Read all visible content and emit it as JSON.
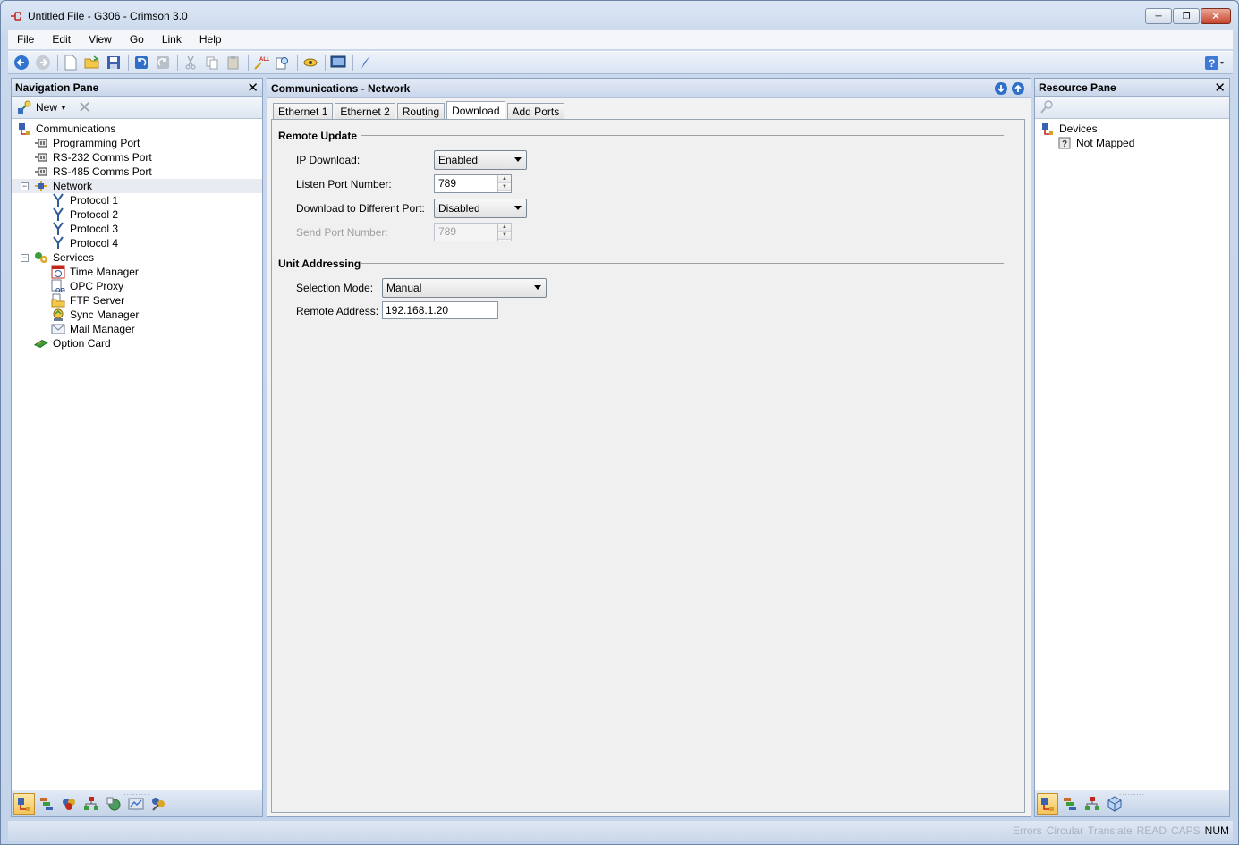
{
  "window": {
    "title": "Untitled File - G306 - Crimson 3.0"
  },
  "menu": [
    "File",
    "Edit",
    "View",
    "Go",
    "Link",
    "Help"
  ],
  "nav_pane": {
    "title": "Navigation Pane",
    "new_label": "New",
    "tree": [
      {
        "label": "Communications",
        "level": 0,
        "icon": "communications-icon"
      },
      {
        "label": "Programming Port",
        "level": 1,
        "icon": "port-icon"
      },
      {
        "label": "RS-232 Comms Port",
        "level": 1,
        "icon": "port-icon"
      },
      {
        "label": "RS-485 Comms Port",
        "level": 1,
        "icon": "port-icon"
      },
      {
        "label": "Network",
        "level": 1,
        "icon": "network-icon",
        "expanded": true,
        "selected": true
      },
      {
        "label": "Protocol 1",
        "level": 2,
        "icon": "protocol-icon"
      },
      {
        "label": "Protocol 2",
        "level": 2,
        "icon": "protocol-icon"
      },
      {
        "label": "Protocol 3",
        "level": 2,
        "icon": "protocol-icon"
      },
      {
        "label": "Protocol 4",
        "level": 2,
        "icon": "protocol-icon"
      },
      {
        "label": "Services",
        "level": 1,
        "icon": "services-icon",
        "expanded": true
      },
      {
        "label": "Time Manager",
        "level": 2,
        "icon": "clock-icon"
      },
      {
        "label": "OPC Proxy",
        "level": 2,
        "icon": "opc-icon"
      },
      {
        "label": "FTP Server",
        "level": 2,
        "icon": "folder-icon"
      },
      {
        "label": "Sync Manager",
        "level": 2,
        "icon": "sync-icon"
      },
      {
        "label": "Mail Manager",
        "level": 2,
        "icon": "mail-icon"
      },
      {
        "label": "Option Card",
        "level": 1,
        "icon": "card-icon"
      }
    ]
  },
  "main": {
    "title": "Communications - Network",
    "tabs": [
      "Ethernet 1",
      "Ethernet 2",
      "Routing",
      "Download",
      "Add Ports"
    ],
    "active_tab": "Download",
    "remote_update": {
      "heading": "Remote Update",
      "ip_download_label": "IP Download:",
      "ip_download_value": "Enabled",
      "listen_port_label": "Listen Port Number:",
      "listen_port_value": "789",
      "diff_port_label": "Download to Different Port:",
      "diff_port_value": "Disabled",
      "send_port_label": "Send Port Number:",
      "send_port_value": "789"
    },
    "unit_addressing": {
      "heading": "Unit Addressing",
      "selection_mode_label": "Selection Mode:",
      "selection_mode_value": "Manual",
      "remote_address_label": "Remote Address:",
      "remote_address_value": "192.168.1.20"
    }
  },
  "res_pane": {
    "title": "Resource Pane",
    "tree": [
      {
        "label": "Devices",
        "level": 0,
        "icon": "devices-icon"
      },
      {
        "label": "Not Mapped",
        "level": 1,
        "icon": "question-icon"
      }
    ]
  },
  "status": {
    "errors": "Errors",
    "circular": "Circular",
    "translate": "Translate",
    "read": "READ",
    "caps": "CAPS",
    "num": "NUM"
  }
}
